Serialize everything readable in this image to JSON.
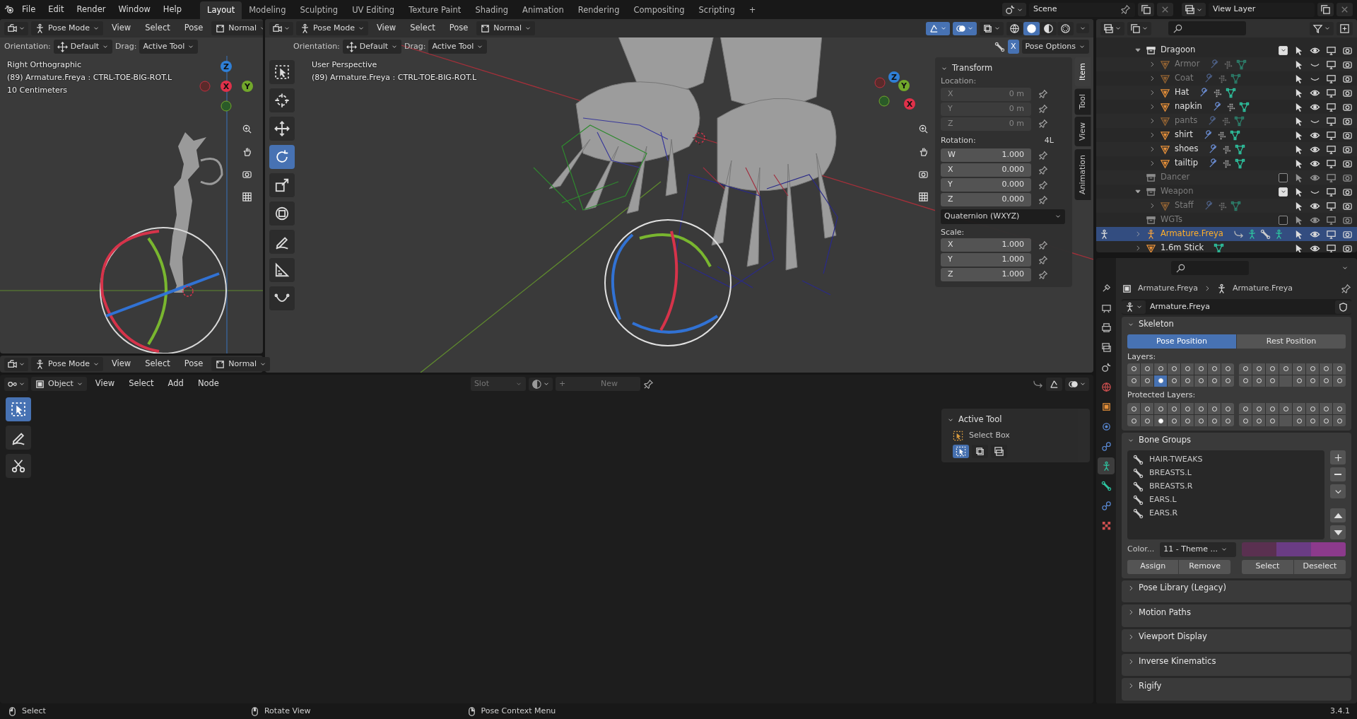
{
  "topbar": {
    "menus": [
      "File",
      "Edit",
      "Render",
      "Window",
      "Help"
    ],
    "workspaces": [
      {
        "label": "Layout",
        "selected": true
      },
      {
        "label": "Modeling",
        "selected": false
      },
      {
        "label": "Sculpting",
        "selected": false
      },
      {
        "label": "UV Editing",
        "selected": false
      },
      {
        "label": "Texture Paint",
        "selected": false
      },
      {
        "label": "Shading",
        "selected": false
      },
      {
        "label": "Animation",
        "selected": false
      },
      {
        "label": "Rendering",
        "selected": false
      },
      {
        "label": "Compositing",
        "selected": false
      },
      {
        "label": "Scripting",
        "selected": false
      }
    ],
    "add_workspace": "+",
    "scene": "Scene",
    "view_layer": "View Layer"
  },
  "left_viewport": {
    "mode": "Pose Mode",
    "menus": [
      "View",
      "Select",
      "Pose"
    ],
    "transform_orientation": "Normal",
    "orientation_label": "Orientation:",
    "orientation": "Default",
    "drag_label": "Drag:",
    "drag": "Active Tool",
    "overlay": [
      "Right Orthographic",
      "(89) Armature.Freya : CTRL-TOE-BIG-ROT.L",
      "10 Centimeters"
    ],
    "gizmo": [
      "Z",
      "X",
      "Y"
    ]
  },
  "main_viewport": {
    "mode": "Pose Mode",
    "menus": [
      "View",
      "Select",
      "Pose"
    ],
    "transform_orientation": "Normal",
    "orientation_label": "Orientation:",
    "orientation": "Default",
    "drag_label": "Drag:",
    "drag": "Active Tool",
    "toggles": [
      {
        "kind": "gizmo",
        "on": true
      },
      {
        "kind": "overlay",
        "on": true
      },
      {
        "kind": "xray",
        "on": false
      }
    ],
    "shading": [
      {
        "kind": "wireframe",
        "selected": false
      },
      {
        "kind": "solid",
        "selected": true
      },
      {
        "kind": "material",
        "selected": false
      },
      {
        "kind": "rendered",
        "selected": false
      }
    ],
    "x_mirror": {
      "label": "X",
      "on": true
    },
    "pose_options": "Pose Options",
    "overlay": [
      "User Perspective",
      "(89) Armature.Freya : CTRL-TOE-BIG-ROT.L"
    ],
    "gizmo": [
      "Z",
      "Y",
      "X"
    ],
    "tools": [
      {
        "kind": "select",
        "selected": false
      },
      {
        "kind": "cursor",
        "selected": false
      },
      {
        "kind": "move",
        "selected": false
      },
      {
        "kind": "rotate",
        "selected": true
      },
      {
        "kind": "scale",
        "selected": false
      },
      {
        "kind": "transform",
        "selected": false
      },
      {
        "kind": "annotate",
        "selected": false
      },
      {
        "kind": "measure",
        "selected": false
      },
      {
        "kind": "curve",
        "selected": false
      }
    ],
    "sidebar": {
      "tabs": [
        {
          "label": "Item",
          "selected": true
        },
        {
          "label": "Tool",
          "selected": false
        },
        {
          "label": "View",
          "selected": false
        },
        {
          "label": "Animation",
          "selected": false
        }
      ],
      "panel_title": "Transform",
      "location_label": "Location:",
      "location": [
        {
          "axis": "X",
          "value": "0 m",
          "disabled": true
        },
        {
          "axis": "Y",
          "value": "0 m",
          "disabled": true
        },
        {
          "axis": "Z",
          "value": "0 m",
          "disabled": true
        }
      ],
      "rotation_label": "Rotation:",
      "rotation_badge": "4L",
      "rotation": [
        {
          "axis": "W",
          "value": "1.000",
          "disabled": false
        },
        {
          "axis": "X",
          "value": "0.000",
          "disabled": false
        },
        {
          "axis": "Y",
          "value": "0.000",
          "disabled": false
        },
        {
          "axis": "Z",
          "value": "0.000",
          "disabled": false
        }
      ],
      "rotation_mode": "Quaternion (WXYZ)",
      "scale_label": "Scale:",
      "scale": [
        {
          "axis": "X",
          "value": "1.000",
          "disabled": false
        },
        {
          "axis": "Y",
          "value": "1.000",
          "disabled": false
        },
        {
          "axis": "Z",
          "value": "1.000",
          "disabled": false
        }
      ]
    }
  },
  "lower_header": {
    "mode": "Pose Mode",
    "menus": [
      "View",
      "Select",
      "Pose"
    ],
    "transform_orientation": "Normal"
  },
  "node_editor": {
    "data_type": "Object",
    "menus": [
      "View",
      "Select",
      "Add",
      "Node"
    ],
    "slot": "Slot",
    "new_plus": "+",
    "new_button": "New",
    "tools": [
      {
        "kind": "select",
        "selected": true
      },
      {
        "kind": "annotate",
        "selected": false
      },
      {
        "kind": "cut",
        "selected": false
      }
    ],
    "sidebar": {
      "panel_title": "Active Tool",
      "tool_name": "Select Box"
    }
  },
  "outliner": {
    "rows": [
      {
        "name": "Dragoon",
        "kind": "collection",
        "checked": true,
        "visible": true,
        "expanded": true,
        "selected": false,
        "children": [
          {
            "name": "Armor",
            "kind": "mesh",
            "modifiers": true,
            "visible": false,
            "expanded": false,
            "selected": false
          },
          {
            "name": "Coat",
            "kind": "mesh",
            "modifiers": true,
            "visible": false,
            "expanded": false,
            "selected": false
          },
          {
            "name": "Hat",
            "kind": "mesh",
            "modifiers": true,
            "visible": true,
            "expanded": false,
            "selected": false
          },
          {
            "name": "napkin",
            "kind": "mesh",
            "modifiers": true,
            "visible": true,
            "expanded": false,
            "selected": false
          },
          {
            "name": "pants",
            "kind": "mesh",
            "modifiers": true,
            "visible": false,
            "expanded": false,
            "selected": false
          },
          {
            "name": "shirt",
            "kind": "mesh",
            "modifiers": true,
            "visible": true,
            "expanded": false,
            "selected": false
          },
          {
            "name": "shoes",
            "kind": "mesh",
            "modifiers": true,
            "visible": true,
            "expanded": false,
            "selected": false
          },
          {
            "name": "tailtip",
            "kind": "mesh",
            "modifiers": true,
            "visible": true,
            "expanded": false,
            "selected": false
          }
        ]
      },
      {
        "name": "Dancer",
        "kind": "collection",
        "checked": false,
        "visible": true,
        "selected": false
      },
      {
        "name": "Weapon",
        "kind": "collection",
        "checked": true,
        "visible": false,
        "expanded": true,
        "selected": false,
        "children": [
          {
            "name": "Staff",
            "kind": "mesh",
            "modifiers": true,
            "visible": true,
            "expanded": false,
            "selected": false
          }
        ]
      },
      {
        "name": "WGTs",
        "kind": "collection",
        "checked": false,
        "visible": true,
        "selected": false
      },
      {
        "name": "Armature.Freya",
        "kind": "armature",
        "visible": true,
        "expanded": false,
        "selected": true
      },
      {
        "name": "1.6m Stick",
        "kind": "mesh",
        "modifiers": false,
        "visible": true,
        "expanded": false,
        "selected": false
      }
    ]
  },
  "properties": {
    "tabs": [
      {
        "kind": "tool",
        "selected": false
      },
      {
        "kind": "render",
        "selected": false
      },
      {
        "kind": "output",
        "selected": false
      },
      {
        "kind": "view-layer",
        "selected": false
      },
      {
        "kind": "scene",
        "selected": false
      },
      {
        "kind": "world",
        "selected": false
      },
      {
        "kind": "object",
        "selected": false
      },
      {
        "kind": "physics",
        "selected": false
      },
      {
        "kind": "constraint",
        "selected": false
      },
      {
        "kind": "armature",
        "selected": true
      },
      {
        "kind": "bone",
        "selected": false
      },
      {
        "kind": "bone-constraint",
        "selected": false
      },
      {
        "kind": "texture",
        "selected": false
      }
    ],
    "breadcrumb": [
      "Armature.Freya",
      "Armature.Freya"
    ],
    "data_name": "Armature.Freya",
    "skeleton": {
      "title": "Skeleton",
      "expanded": true,
      "positions": [
        {
          "label": "Pose Position",
          "selected": true
        },
        {
          "label": "Rest Position",
          "selected": false
        }
      ],
      "layers_label": "Layers:",
      "layers": [
        {
          "on": false,
          "used": true
        },
        {
          "on": false,
          "used": true
        },
        {
          "on": false,
          "used": true
        },
        {
          "on": false,
          "used": true
        },
        {
          "on": false,
          "used": true
        },
        {
          "on": false,
          "used": true
        },
        {
          "on": false,
          "used": true
        },
        {
          "on": false,
          "used": true
        },
        {
          "on": false,
          "used": true
        },
        {
          "on": false,
          "used": true
        },
        {
          "on": false,
          "used": true
        },
        {
          "on": false,
          "used": true
        },
        {
          "on": false,
          "used": true
        },
        {
          "on": false,
          "used": true
        },
        {
          "on": false,
          "used": true
        },
        {
          "on": false,
          "used": true
        },
        {
          "on": false,
          "used": true
        },
        {
          "on": false,
          "used": true
        },
        {
          "on": true,
          "used": true
        },
        {
          "on": false,
          "used": true
        },
        {
          "on": false,
          "used": true
        },
        {
          "on": false,
          "used": true
        },
        {
          "on": false,
          "used": true
        },
        {
          "on": false,
          "used": true
        },
        {
          "on": false,
          "used": true
        },
        {
          "on": false,
          "used": true
        },
        {
          "on": false,
          "used": true
        },
        {
          "on": false,
          "used": false
        },
        {
          "on": false,
          "used": true
        },
        {
          "on": false,
          "used": true
        },
        {
          "on": false,
          "used": true
        },
        {
          "on": false,
          "used": true
        }
      ],
      "protected_label": "Protected Layers:",
      "protected_layers": [
        {
          "on": false,
          "used": true
        },
        {
          "on": false,
          "used": true
        },
        {
          "on": false,
          "used": true
        },
        {
          "on": false,
          "used": true
        },
        {
          "on": false,
          "used": true
        },
        {
          "on": false,
          "used": true
        },
        {
          "on": false,
          "used": true
        },
        {
          "on": false,
          "used": true
        },
        {
          "on": false,
          "used": true
        },
        {
          "on": false,
          "used": true
        },
        {
          "on": false,
          "used": true
        },
        {
          "on": false,
          "used": true
        },
        {
          "on": false,
          "used": true
        },
        {
          "on": false,
          "used": true
        },
        {
          "on": false,
          "used": true
        },
        {
          "on": false,
          "used": true
        },
        {
          "on": false,
          "used": true
        },
        {
          "on": false,
          "used": true
        },
        {
          "on": true,
          "used": true
        },
        {
          "on": false,
          "used": true
        },
        {
          "on": false,
          "used": true
        },
        {
          "on": false,
          "used": true
        },
        {
          "on": false,
          "used": true
        },
        {
          "on": false,
          "used": true
        },
        {
          "on": false,
          "used": true
        },
        {
          "on": false,
          "used": true
        },
        {
          "on": false,
          "used": true
        },
        {
          "on": false,
          "used": false
        },
        {
          "on": false,
          "used": true
        },
        {
          "on": false,
          "used": true
        },
        {
          "on": false,
          "used": true
        },
        {
          "on": false,
          "used": true
        }
      ]
    },
    "bone_groups": {
      "title": "Bone Groups",
      "expanded": true,
      "items": [
        "HAIR-TWEAKS",
        "BREASTS.L",
        "BREASTS.R",
        "EARS.L",
        "EARS.R"
      ],
      "color_set_label": "Color...",
      "color_set": "11 - Theme ...",
      "swatches": [
        {
          "color": "#5a3050"
        },
        {
          "color": "#6a3c84"
        },
        {
          "color": "#8c3a8c"
        }
      ],
      "buttons": [
        "Assign",
        "Remove",
        "Select",
        "Deselect"
      ]
    },
    "collapsed_panels": [
      {
        "title": "Pose Library (Legacy)",
        "expanded": false
      },
      {
        "title": "Motion Paths",
        "expanded": false
      },
      {
        "title": "Viewport Display",
        "expanded": false
      },
      {
        "title": "Inverse Kinematics",
        "expanded": false
      },
      {
        "title": "Rigify",
        "expanded": false
      }
    ]
  },
  "status_bar": {
    "hints": [
      {
        "kind": "mouse-left",
        "label": "Select"
      },
      {
        "kind": "mouse-middle",
        "label": "Rotate View"
      },
      {
        "kind": "mouse-right",
        "label": "Pose Context Menu"
      }
    ],
    "version": "3.4.1"
  }
}
